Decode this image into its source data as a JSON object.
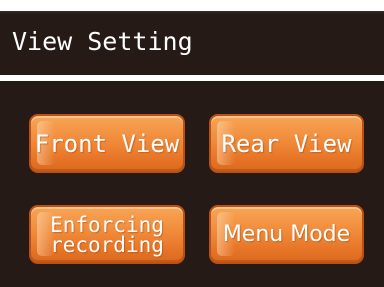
{
  "header": {
    "title": "View Setting"
  },
  "buttons": {
    "front_view": "Front View",
    "rear_view": "Rear View",
    "enforcing_recording_line1": "Enforcing",
    "enforcing_recording_line2": "recording",
    "menu_mode": "Menu Mode"
  },
  "colors": {
    "screen_background": "#251a16",
    "button_orange": "#f08b3a",
    "button_border": "#b95117",
    "text": "#ffffff"
  }
}
